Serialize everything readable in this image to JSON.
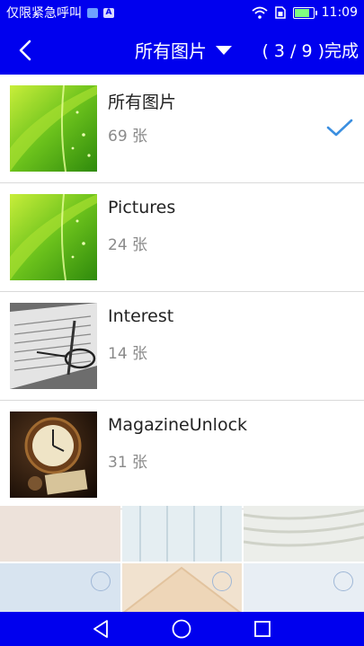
{
  "status_bar": {
    "notification_text": "仅限紧急呼叫",
    "time": "11:09",
    "battery_level": 0.85,
    "icons": [
      "message-icon",
      "app-a-icon",
      "wifi-icon",
      "sim-icon",
      "battery-icon"
    ]
  },
  "header": {
    "title": "所有图片",
    "done_label": "( 3 / 9 )完成",
    "background": "#0000ee"
  },
  "albums": [
    {
      "name": "所有图片",
      "count": "69 张",
      "selected": true
    },
    {
      "name": "Pictures",
      "count": "24 张",
      "selected": false
    },
    {
      "name": "Interest",
      "count": "14 张",
      "selected": false
    },
    {
      "name": "MagazineUnlock",
      "count": "31 张",
      "selected": false
    }
  ],
  "colors": {
    "accent_blue": "#0000ee",
    "check": "#3b8fe0",
    "divider": "#d9d9d9"
  }
}
